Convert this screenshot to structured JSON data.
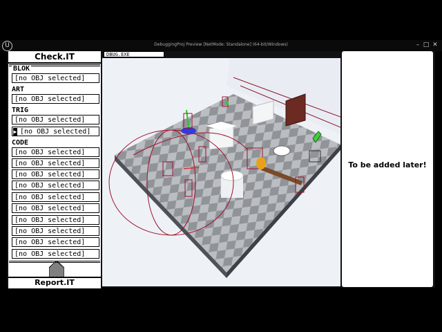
{
  "window": {
    "title": "DebuggingProj Preview [NetMode: Standalone] (64-bit/Windows)",
    "logo": "U",
    "buttons": [
      "–",
      "□",
      "✕"
    ]
  },
  "left_panel": {
    "title": "Check.IT",
    "sections": [
      {
        "label": "BLOK",
        "fields": [
          "[no OBJ selected]"
        ]
      },
      {
        "label": "ART",
        "fields": [
          "[no OBJ selected]"
        ]
      },
      {
        "label": "TRIG",
        "fields": [
          "[no OBJ selected]",
          "[no OBJ selected]"
        ]
      },
      {
        "label": "CODE",
        "fields": [
          "[no OBJ selected]",
          "[no OBJ selected]",
          "[no OBJ selected]",
          "[no OBJ selected]",
          "[no OBJ selected]",
          "[no OBJ selected]",
          "[no OBJ selected]",
          "[no OBJ selected]",
          "[no OBJ selected]",
          "[no OBJ selected]"
        ]
      }
    ],
    "selected_cursor": "▶",
    "report_button": "Report.IT"
  },
  "viewport": {
    "tab_label": "DBUG.EXE"
  },
  "right_panel": {
    "text": "To be added later!"
  },
  "colors": {
    "background": "#000000",
    "panel": "#ffffff",
    "floor_light": "#b9bcc0",
    "floor_dark": "#8f9296",
    "debug_wire": "#a0102a"
  }
}
